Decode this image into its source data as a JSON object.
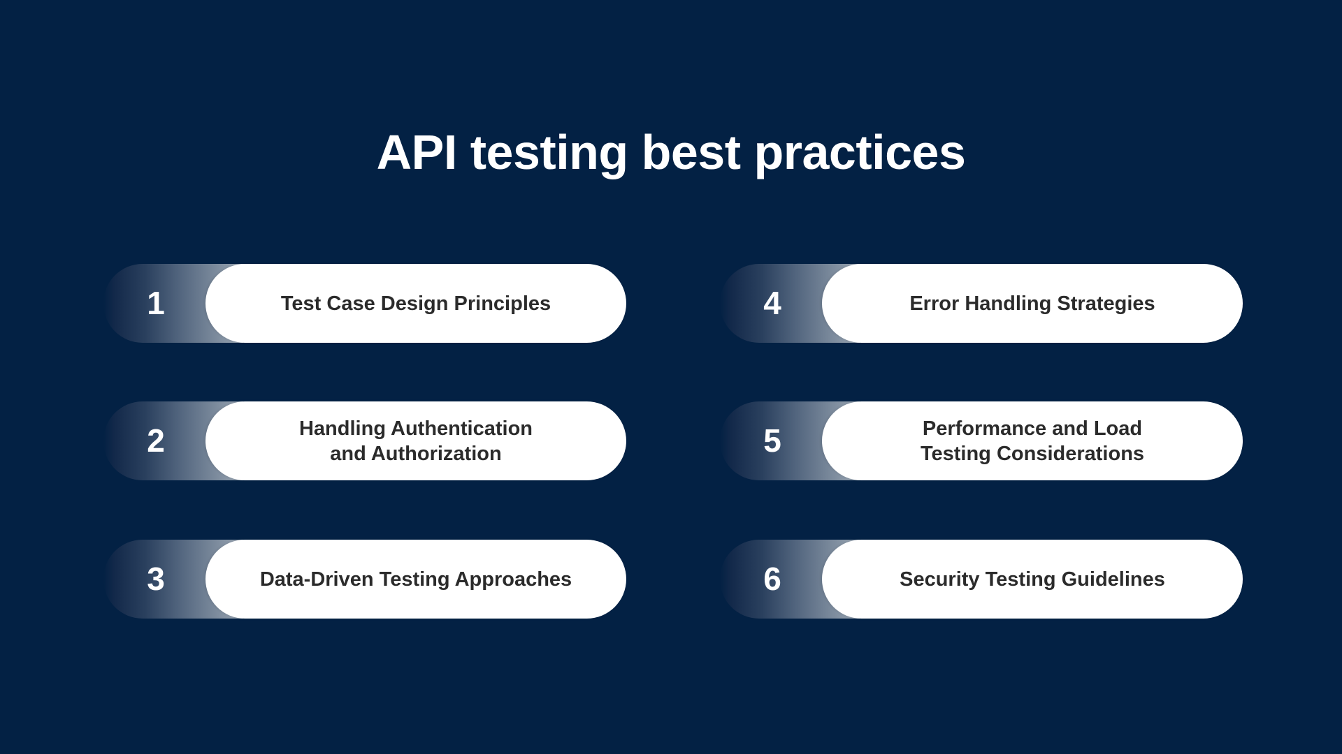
{
  "slide": {
    "title": "API testing best practices",
    "background_color": "#032144",
    "card_color": "#ffffff",
    "text_color": "#2b2b2b",
    "items": [
      {
        "number": "1",
        "label": "Test Case Design Principles"
      },
      {
        "number": "2",
        "label": "Handling Authentication and Authorization"
      },
      {
        "number": "3",
        "label": "Data-Driven Testing Approaches"
      },
      {
        "number": "4",
        "label": "Error Handling Strategies"
      },
      {
        "number": "5",
        "label": "Performance and Load Testing Considerations"
      },
      {
        "number": "6",
        "label": "Security Testing Guidelines"
      }
    ]
  }
}
